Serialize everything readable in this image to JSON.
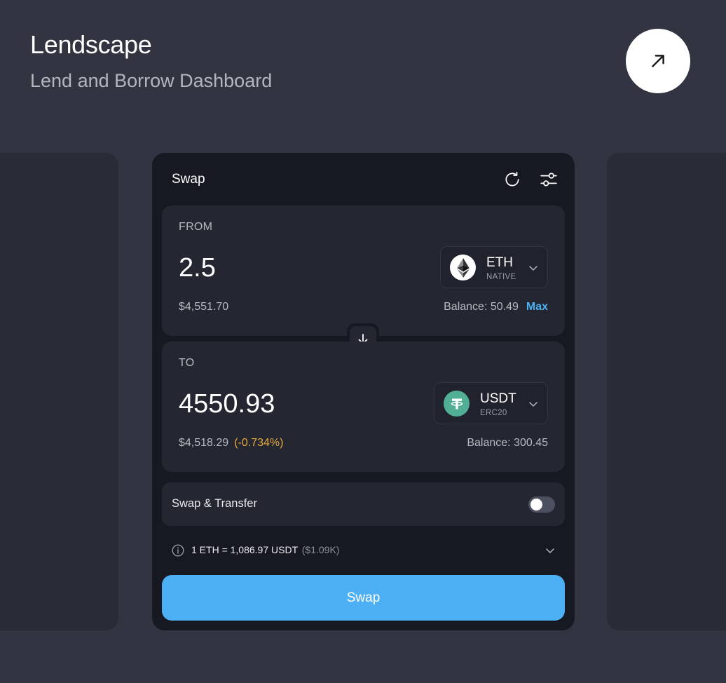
{
  "header": {
    "title": "Lendscape",
    "subtitle": "Lend and Borrow Dashboard",
    "open_icon": "arrow-up-right-icon"
  },
  "swap": {
    "title": "Swap",
    "refresh_icon": "refresh-icon",
    "settings_icon": "sliders-icon",
    "from": {
      "label": "FROM",
      "amount": "2.5",
      "fiat_value": "$4,551.70",
      "balance_text": "Balance: 50.49",
      "max_label": "Max",
      "token": {
        "symbol": "ETH",
        "network": "NATIVE",
        "icon": "ethereum-logo-icon"
      }
    },
    "direction_icon": "arrow-down-icon",
    "to": {
      "label": "TO",
      "amount": "4550.93",
      "fiat_value": "$4,518.29",
      "price_impact": "(-0.734%)",
      "balance_text": "Balance: 300.45",
      "token": {
        "symbol": "USDT",
        "network": "ERC20",
        "icon": "tether-logo-icon"
      }
    },
    "transfer": {
      "label": "Swap & Transfer",
      "enabled": false
    },
    "rate": {
      "text": "1 ETH = 1,086.97 USDT",
      "usd": "($1.09K)"
    },
    "submit_label": "Swap"
  },
  "colors": {
    "background": "#323441",
    "card": "#161922",
    "panel": "#242632",
    "accent": "#4eb0f4",
    "warning": "#e5a93b",
    "tether": "#50af95"
  }
}
